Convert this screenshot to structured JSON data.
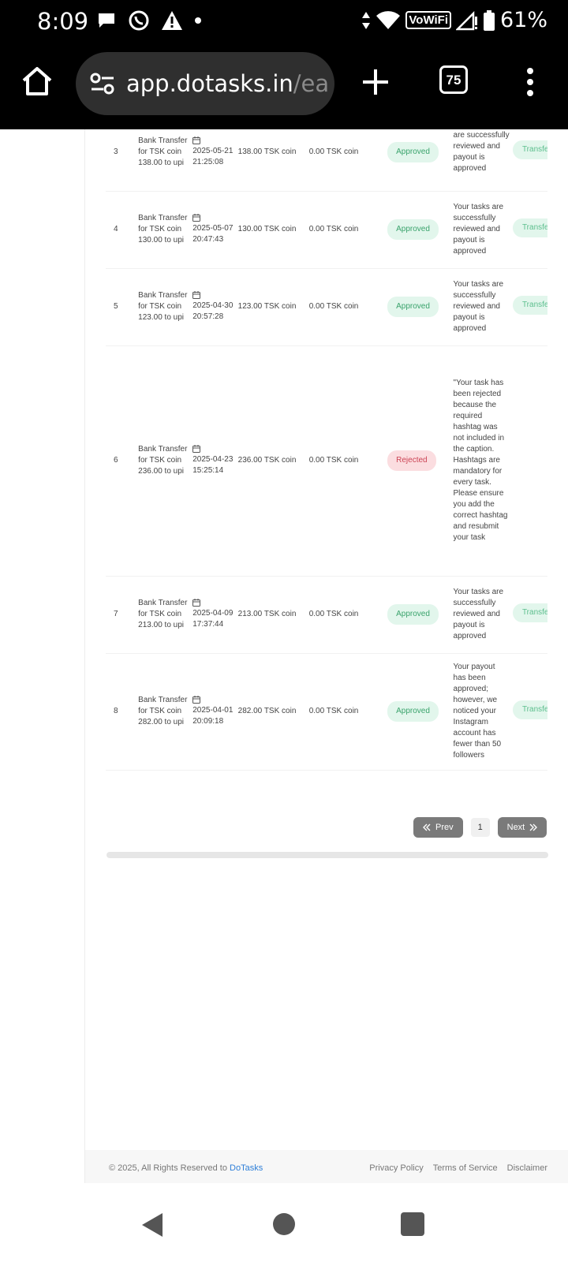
{
  "status_bar": {
    "time": "8:09",
    "network_label": "VoWiFi",
    "battery": "61%"
  },
  "browser": {
    "url_main": "app.dotasks.in",
    "url_rest": "/ea",
    "tab_count": "75"
  },
  "transactions": {
    "rows": [
      {
        "id": "3",
        "description": "Bank Transfer for TSK coin 138.00 to upi",
        "date": "2025-05-21 21:25:08",
        "amount": "138.00 TSK coin",
        "fee": "0.00 TSK coin",
        "status": "Approved",
        "remark": "are successfully reviewed and payout is approved",
        "action": "Transfer"
      },
      {
        "id": "4",
        "description": "Bank Transfer for TSK coin 130.00 to upi",
        "date": "2025-05-07 20:47:43",
        "amount": "130.00 TSK coin",
        "fee": "0.00 TSK coin",
        "status": "Approved",
        "remark": "Your tasks are successfully reviewed and payout is approved",
        "action": "Transfer"
      },
      {
        "id": "5",
        "description": "Bank Transfer for TSK coin 123.00 to upi",
        "date": "2025-04-30 20:57:28",
        "amount": "123.00 TSK coin",
        "fee": "0.00 TSK coin",
        "status": "Approved",
        "remark": "Your tasks are successfully reviewed and payout is approved",
        "action": "Transfer"
      },
      {
        "id": "6",
        "description": "Bank Transfer for TSK coin 236.00 to upi",
        "date": "2025-04-23 15:25:14",
        "amount": "236.00 TSK coin",
        "fee": "0.00 TSK coin",
        "status": "Rejected",
        "remark": "\"Your task has been rejected because the required hashtag was not included in the caption. Hashtags are mandatory for every task. Please ensure you add the correct hashtag and resubmit your task",
        "action": ""
      },
      {
        "id": "7",
        "description": "Bank Transfer for TSK coin 213.00 to upi",
        "date": "2025-04-09 17:37:44",
        "amount": "213.00 TSK coin",
        "fee": "0.00 TSK coin",
        "status": "Approved",
        "remark": "Your tasks are successfully reviewed and payout is approved",
        "action": "Transfer"
      },
      {
        "id": "8",
        "description": "Bank Transfer for TSK coin 282.00 to upi",
        "date": "2025-04-01 20:09:18",
        "amount": "282.00 TSK coin",
        "fee": "0.00 TSK coin",
        "status": "Approved",
        "remark": "Your payout has been approved; however, we noticed your Instagram account has fewer than 50 followers",
        "action": "Transfer"
      }
    ]
  },
  "pagination": {
    "prev_label": "Prev",
    "page": "1",
    "next_label": "Next"
  },
  "footer": {
    "copyright": "© 2025, All Rights Reserved to",
    "brand": "DoTasks",
    "links": [
      "Privacy Policy",
      "Terms of Service",
      "Disclaimer"
    ]
  },
  "colors": {
    "approved_bg": "#e2f6ec",
    "approved_text": "#3aa36c",
    "rejected_bg": "#fbdde0",
    "rejected_text": "#cc4455",
    "brand_link": "#2f7fd8"
  }
}
